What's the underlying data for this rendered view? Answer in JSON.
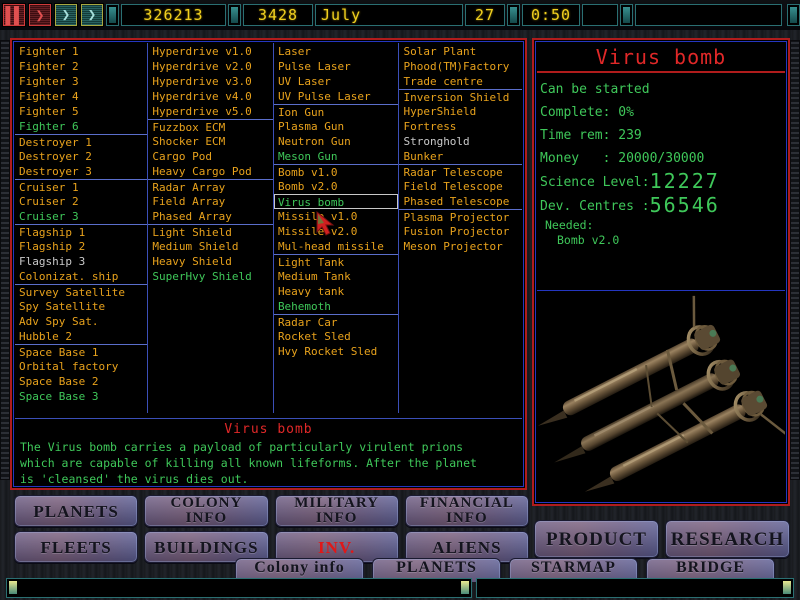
{
  "topbar": {
    "controls": [
      {
        "name": "pause-button",
        "glyph": "‖",
        "style": "red"
      },
      {
        "name": "play-button",
        "glyph": "❯",
        "style": "red"
      },
      {
        "name": "fast-forward-button",
        "glyph": "❯",
        "style": "teal"
      },
      {
        "name": "very-fast-forward-button",
        "glyph": "❯",
        "style": "teal"
      }
    ],
    "money": "326213",
    "population": "3428",
    "month": "July",
    "day": "27",
    "time": "0:50",
    "status": ""
  },
  "inventory": {
    "columns": [
      {
        "name": "ships-column",
        "items": [
          {
            "label": "Fighter 1",
            "state": "normal"
          },
          {
            "label": "Fighter 2",
            "state": "normal"
          },
          {
            "label": "Fighter 3",
            "state": "normal"
          },
          {
            "label": "Fighter 4",
            "state": "normal"
          },
          {
            "label": "Fighter 5",
            "state": "normal"
          },
          {
            "label": "Fighter 6",
            "state": "green"
          },
          {
            "label": "Destroyer 1",
            "state": "normal",
            "sep": true
          },
          {
            "label": "Destroyer 2",
            "state": "normal"
          },
          {
            "label": "Destroyer 3",
            "state": "normal"
          },
          {
            "label": "Cruiser 1",
            "state": "normal",
            "sep": true
          },
          {
            "label": "Cruiser 2",
            "state": "normal"
          },
          {
            "label": "Cruiser 3",
            "state": "green"
          },
          {
            "label": "Flagship 1",
            "state": "normal",
            "sep": true
          },
          {
            "label": "Flagship 2",
            "state": "normal"
          },
          {
            "label": "Flagship 3",
            "state": "grey"
          },
          {
            "label": "Colonizat. ship",
            "state": "normal"
          },
          {
            "label": "Survey Satellite",
            "state": "normal",
            "sep": true
          },
          {
            "label": "Spy Satellite",
            "state": "normal"
          },
          {
            "label": "Adv Spy Sat.",
            "state": "normal"
          },
          {
            "label": "Hubble 2",
            "state": "normal"
          },
          {
            "label": "Space Base 1",
            "state": "normal",
            "sep": true
          },
          {
            "label": "Orbital factory",
            "state": "normal"
          },
          {
            "label": "Space Base 2",
            "state": "normal"
          },
          {
            "label": "Space Base 3",
            "state": "green"
          }
        ]
      },
      {
        "name": "components-column",
        "items": [
          {
            "label": "Hyperdrive v1.0",
            "state": "normal"
          },
          {
            "label": "Hyperdrive v2.0",
            "state": "normal"
          },
          {
            "label": "Hyperdrive v3.0",
            "state": "normal"
          },
          {
            "label": "Hyperdrive v4.0",
            "state": "normal"
          },
          {
            "label": "Hyperdrive v5.0",
            "state": "normal"
          },
          {
            "label": "Fuzzbox ECM",
            "state": "normal",
            "sep": true
          },
          {
            "label": "Shocker ECM",
            "state": "normal"
          },
          {
            "label": "Cargo Pod",
            "state": "normal"
          },
          {
            "label": "Heavy Cargo Pod",
            "state": "normal"
          },
          {
            "label": "Radar Array",
            "state": "normal",
            "sep": true
          },
          {
            "label": "Field Array",
            "state": "normal"
          },
          {
            "label": "Phased Array",
            "state": "normal"
          },
          {
            "label": "Light Shield",
            "state": "normal",
            "sep": true
          },
          {
            "label": "Medium Shield",
            "state": "normal"
          },
          {
            "label": "Heavy Shield",
            "state": "normal"
          },
          {
            "label": "SuperHvy Shield",
            "state": "green"
          }
        ]
      },
      {
        "name": "weapons-column",
        "items": [
          {
            "label": "Laser",
            "state": "normal"
          },
          {
            "label": "Pulse Laser",
            "state": "normal"
          },
          {
            "label": "UV Laser",
            "state": "normal"
          },
          {
            "label": "UV Pulse Laser",
            "state": "normal"
          },
          {
            "label": "Ion Gun",
            "state": "normal",
            "sep": true
          },
          {
            "label": "Plasma Gun",
            "state": "normal"
          },
          {
            "label": "Neutron Gun",
            "state": "normal"
          },
          {
            "label": "Meson Gun",
            "state": "green"
          },
          {
            "label": "Bomb v1.0",
            "state": "normal",
            "sep": true
          },
          {
            "label": "Bomb v2.0",
            "state": "normal"
          },
          {
            "label": "Virus bomb",
            "state": "selected"
          },
          {
            "label": "Missile v1.0",
            "state": "normal"
          },
          {
            "label": "Missile v2.0",
            "state": "normal"
          },
          {
            "label": "Mul-head missile",
            "state": "normal"
          },
          {
            "label": "Light Tank",
            "state": "normal",
            "sep": true
          },
          {
            "label": "Medium Tank",
            "state": "normal"
          },
          {
            "label": "Heavy tank",
            "state": "normal"
          },
          {
            "label": "Behemoth",
            "state": "green"
          },
          {
            "label": "Radar Car",
            "state": "normal",
            "sep": true
          },
          {
            "label": "Rocket Sled",
            "state": "normal"
          },
          {
            "label": "Hvy Rocket Sled",
            "state": "normal"
          }
        ]
      },
      {
        "name": "buildings-column",
        "items": [
          {
            "label": "Solar Plant",
            "state": "normal"
          },
          {
            "label": "Phood(TM)Factory",
            "state": "normal"
          },
          {
            "label": "Trade centre",
            "state": "normal"
          },
          {
            "label": "Inversion Shield",
            "state": "normal",
            "sep": true
          },
          {
            "label": "HyperShield",
            "state": "normal"
          },
          {
            "label": "Fortress",
            "state": "normal"
          },
          {
            "label": "Stronghold",
            "state": "grey"
          },
          {
            "label": "Bunker",
            "state": "normal"
          },
          {
            "label": "Radar Telescope",
            "state": "normal",
            "sep": true
          },
          {
            "label": "Field Telescope",
            "state": "normal"
          },
          {
            "label": "Phased Telescope",
            "state": "normal"
          },
          {
            "label": "Plasma Projector",
            "state": "normal",
            "sep": true
          },
          {
            "label": "Fusion Projector",
            "state": "normal"
          },
          {
            "label": "Meson Projector",
            "state": "normal"
          }
        ]
      }
    ]
  },
  "description": {
    "title": "Virus bomb",
    "lines": [
      "The Virus bomb carries a payload of particularly virulent prions",
      "which are capable of killing all known lifeforms. After the planet",
      "is 'cleansed' the virus dies out."
    ]
  },
  "detail": {
    "title": "Virus bomb",
    "status": "Can be started",
    "complete_label": "Complete: ",
    "complete_value": "0%",
    "time_label": "Time rem: ",
    "time_value": "239",
    "money_label": "Money   : ",
    "money_value": "20000/30000",
    "science_label": "Science Level:",
    "science_value": "1222",
    "science_value_hi": "7",
    "dev_label": "Dev. Centres :",
    "dev_value": "56546",
    "needed_label": "Needed:",
    "needed_item": "Bomb v2.0",
    "art_name": "virus-bomb-render"
  },
  "buttons": {
    "row1": [
      {
        "name": "planets-button",
        "label": "PLANETS",
        "lines": 1,
        "highlight": false
      },
      {
        "name": "colony-info-button",
        "label": "COLONY\nINFO",
        "lines": 2,
        "highlight": false
      },
      {
        "name": "military-info-button",
        "label": "MILITARY\nINFO",
        "lines": 2,
        "highlight": false
      },
      {
        "name": "financial-info-button",
        "label": "FINANCIAL\nINFO",
        "lines": 2,
        "highlight": false
      }
    ],
    "row2": [
      {
        "name": "fleets-button",
        "label": "FLEETS",
        "lines": 1,
        "highlight": false
      },
      {
        "name": "buildings-button",
        "label": "BUILDINGS",
        "lines": 1,
        "highlight": false
      },
      {
        "name": "inv-button",
        "label": "INV.",
        "lines": 1,
        "highlight": true
      },
      {
        "name": "aliens-button",
        "label": "ALIENS",
        "lines": 1,
        "highlight": false
      }
    ],
    "right": [
      {
        "name": "product-button",
        "label": "PRODUCT"
      },
      {
        "name": "research-button",
        "label": "RESEARCH"
      }
    ],
    "bottom": [
      {
        "name": "colony-info-tab",
        "label": "Colony info"
      },
      {
        "name": "planets-tab",
        "label": "PLANETS"
      },
      {
        "name": "starmap-tab",
        "label": "STARMAP"
      },
      {
        "name": "bridge-tab",
        "label": "BRIDGE"
      }
    ]
  },
  "colors": {
    "amber": "#e8a21c",
    "green": "#3fc85a",
    "red": "#e02828",
    "lcd_yellow": "#f0d020",
    "panel_border_red": "#b01c1c",
    "panel_border_blue": "#2436c0"
  }
}
